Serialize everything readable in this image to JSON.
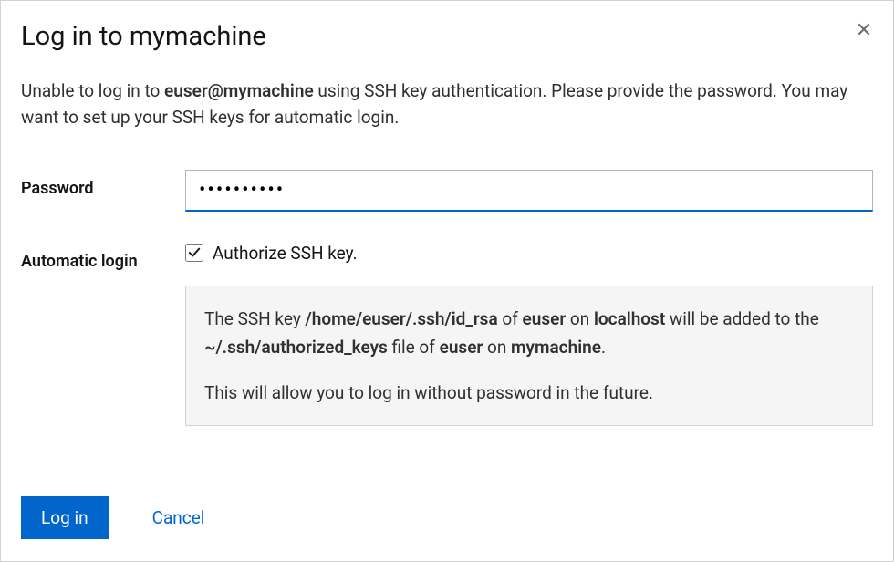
{
  "title": "Log in to mymachine",
  "description": {
    "pre": "Unable to log in to ",
    "user_host": "euser@mymachine",
    "post": " using SSH key authentication. Please provide the password. You may want to set up your SSH keys for automatic login."
  },
  "password": {
    "label": "Password",
    "masked_value": "••••••••••"
  },
  "auto_login": {
    "label": "Automatic login",
    "checkbox_label": "Authorize SSH key.",
    "checked": true,
    "info": {
      "p1": {
        "t1": "The SSH key ",
        "key_path": "/home/euser/.ssh/id_rsa",
        "t2": " of ",
        "user1": "euser",
        "t3": " on ",
        "host1": "localhost",
        "t4": " will be added to the ",
        "auth_file": "~/.ssh/authorized_keys",
        "t5": " file of ",
        "user2": "euser",
        "t6": " on ",
        "host2": "mymachine",
        "t7": "."
      },
      "p2": "This will allow you to log in without password in the future."
    }
  },
  "actions": {
    "primary": "Log in",
    "cancel": "Cancel"
  }
}
